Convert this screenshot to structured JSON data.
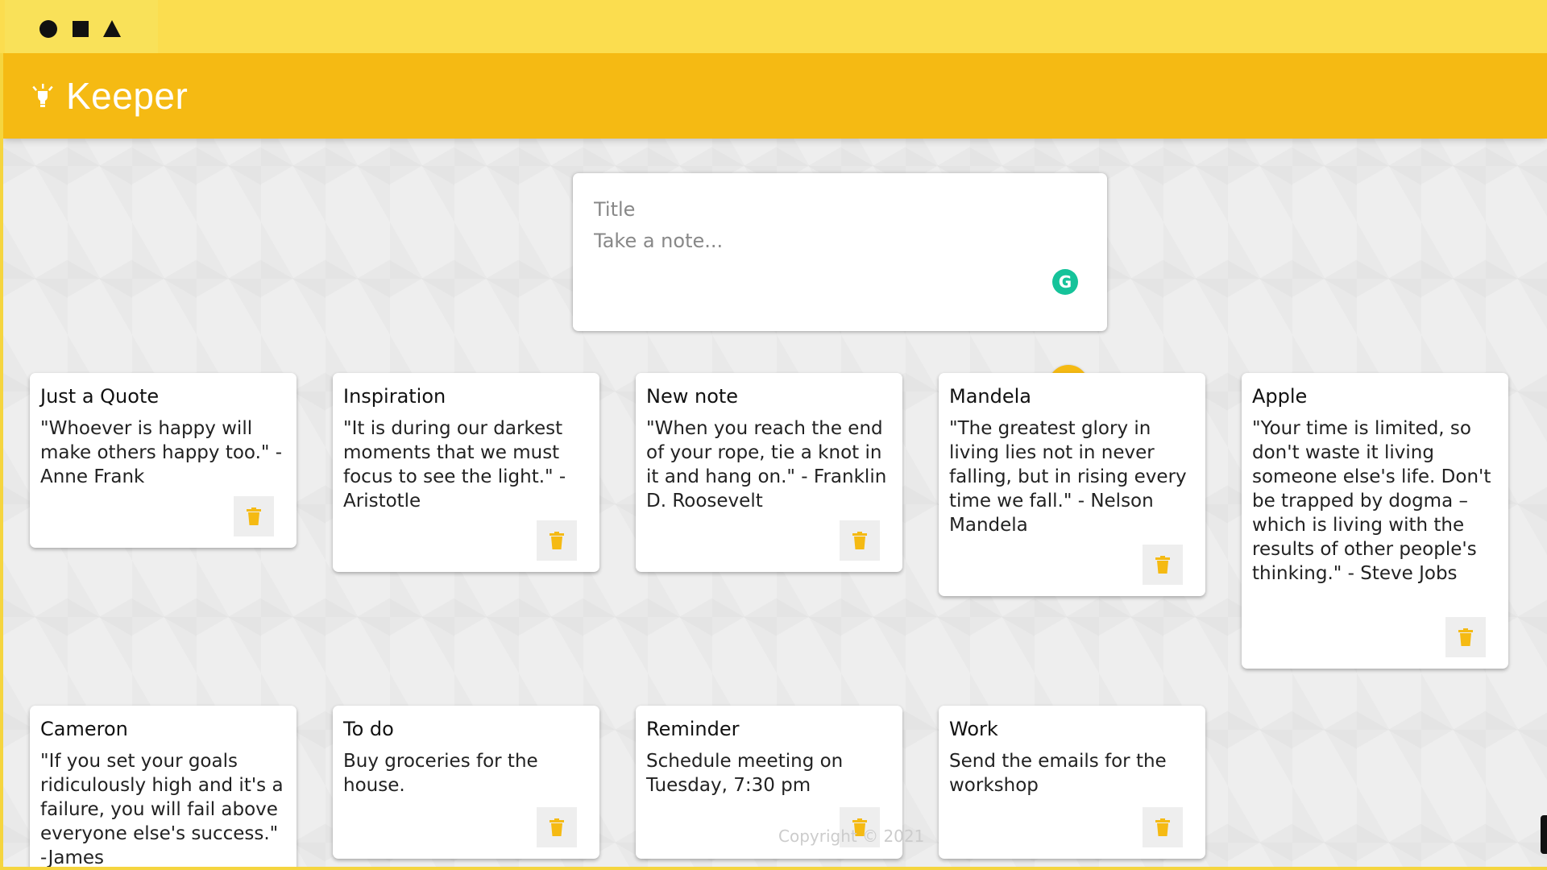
{
  "window": {
    "controls": [
      "circle-control",
      "square-control",
      "triangle-control"
    ]
  },
  "header": {
    "title": "Keeper",
    "icon": "lightbulb-icon"
  },
  "create_note": {
    "title_placeholder": "Title",
    "content_placeholder": "Take a note...",
    "extension_icon": "grammarly-icon",
    "extension_label": "G",
    "add_icon": "plus-icon"
  },
  "notes": [
    {
      "title": "Just a Quote",
      "content": "\"Whoever is happy will make others happy too.\" -Anne Frank"
    },
    {
      "title": "Inspiration",
      "content": "\"It is during our darkest moments that we must focus to see the light.\" - Aristotle"
    },
    {
      "title": "New note",
      "content": "\"When you reach the end of your rope, tie a knot in it and hang on.\" - Franklin D. Roosevelt"
    },
    {
      "title": "Mandela",
      "content": "\"The greatest glory in living lies not in never falling, but in rising every time we fall.\" - Nelson Mandela"
    },
    {
      "title": "Apple",
      "content": "\"Your time is limited, so don't waste it living someone else's life. Don't be trapped by dogma – which is living with the results of other people's thinking.\" - Steve Jobs"
    },
    {
      "title": "Cameron",
      "content": "\"If you set your goals ridiculously high and it's a failure, you will fail above everyone else's success.\" -James"
    },
    {
      "title": "To do",
      "content": "Buy groceries for the house."
    },
    {
      "title": "Reminder",
      "content": "Schedule meeting on Tuesday, 7:30 pm"
    },
    {
      "title": "Work",
      "content": "Send the emails for the workshop"
    }
  ],
  "delete_icon": "trash-icon",
  "footer": {
    "text": "Copyright © 2021"
  },
  "colors": {
    "accent": "#f5ba13",
    "top_bar": "#fbdd4f",
    "background": "#eeeeee",
    "grammarly": "#15c39a"
  }
}
